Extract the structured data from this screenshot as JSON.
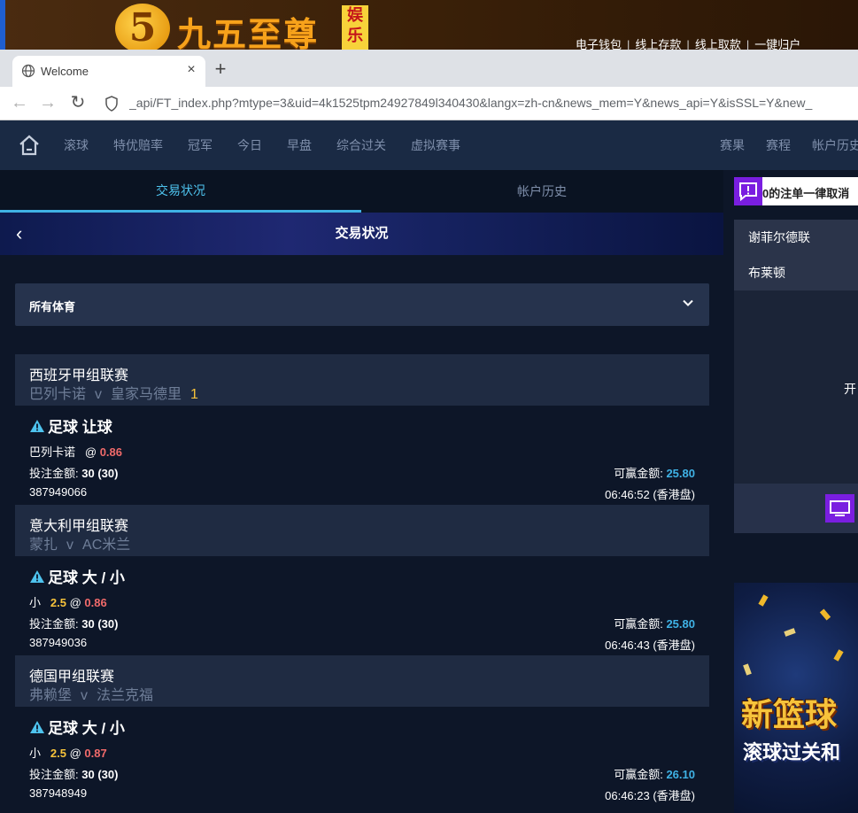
{
  "brand": {
    "logo_digit": "5",
    "logo_name": "九五至尊",
    "logo_side": "娱乐",
    "top_links": [
      "电子钱包",
      "线上存款",
      "线上取款",
      "一键归户"
    ]
  },
  "browser": {
    "tab_title": "Welcome",
    "url": "_api/FT_index.php?mtype=3&uid=4k1525tpm24927849l340430&langx=zh-cn&news_mem=Y&news_api=Y&isSSL=Y&new_"
  },
  "site_nav": {
    "left": [
      "滚球",
      "特优赔率",
      "冠军",
      "今日",
      "早盘",
      "综合过关",
      "虚拟赛事"
    ],
    "right": [
      "赛果",
      "赛程",
      "帐户历史"
    ]
  },
  "main": {
    "tabs": [
      "交易状况",
      "帐户历史"
    ],
    "banner_title": "交易状况",
    "filter_label": "所有体育",
    "stake_label": "投注金额:",
    "win_label": "可赢金额:",
    "bets": [
      {
        "league": "西班牙甲组联赛",
        "home": "巴列卡诺",
        "v": "v",
        "away": "皇家马德里",
        "score": "1",
        "type": "足球 让球",
        "pick_team": "巴列卡诺",
        "pick_line": "",
        "at": "@",
        "odds": "0.86",
        "stake": "30 (30)",
        "win": "25.80",
        "ticket": "387949066",
        "time": "06:46:52 (香港盘)"
      },
      {
        "league": "意大利甲组联赛",
        "home": "蒙扎",
        "v": "v",
        "away": "AC米兰",
        "score": "",
        "type": "足球 大 / 小",
        "pick_team": "小",
        "pick_line": "2.5",
        "at": "@",
        "odds": "0.86",
        "stake": "30 (30)",
        "win": "25.80",
        "ticket": "387949036",
        "time": "06:46:43 (香港盘)"
      },
      {
        "league": "德国甲组联赛",
        "home": "弗赖堡",
        "v": "v",
        "away": "法兰克福",
        "score": "",
        "type": "足球 大 / 小",
        "pick_team": "小",
        "pick_line": "2.5",
        "at": "@",
        "odds": "0.87",
        "stake": "30 (30)",
        "win": "26.10",
        "ticket": "387948949",
        "time": "06:46:23 (香港盘)"
      }
    ]
  },
  "right": {
    "notice": "0的注单一律取消",
    "team1": "谢菲尔德联",
    "team2": "布莱顿",
    "open_text": "开",
    "promo_line1": "新篮球",
    "promo_line2": "滚球过关和"
  },
  "colors": {
    "accent_blue": "#3fb2e5",
    "odds_red": "#f06a6a",
    "line_yellow": "#f7c33b",
    "purple": "#7a1ee0"
  }
}
